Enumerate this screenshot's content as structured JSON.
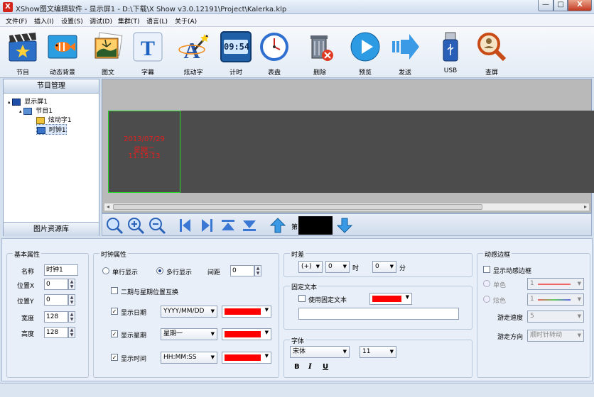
{
  "window": {
    "title": "XShow图文编辑软件 - 显示屏1 - D:\\下载\\X Show v3.0.12191\\Project\\Kalerka.klp",
    "app_icon_letter": "X",
    "min_glyph": "—",
    "max_glyph": "□",
    "close_glyph": "X"
  },
  "menu": [
    "文件(F)",
    "插入(I)",
    "设置(S)",
    "调试(D)",
    "集群(T)",
    "语言(L)",
    "关于(A)"
  ],
  "toolbar": {
    "program": "节目",
    "dynamic_bg": "动态背景",
    "image_text": "图文",
    "caption": "字幕",
    "flash_text": "炫动字",
    "timer": "计时",
    "timer_display": "09:54",
    "clock_face": "表盘",
    "delete": "删除",
    "preview": "预览",
    "send": "发送",
    "usb": "USB",
    "lock_screen": "查屏"
  },
  "left_panel": {
    "header": "节目管理",
    "tree": {
      "screen": "显示屏1",
      "program": "节目1",
      "flash_text": "炫动字1",
      "clock": "时钟1"
    },
    "footer": "图片资源库"
  },
  "canvas": {
    "clock_date": "2013/07/29",
    "clock_weekday": "星期二",
    "clock_time": "11:15:13",
    "scroll_left": "◂",
    "scroll_right": "▸"
  },
  "canvas_toolbar": {
    "page_label": "第"
  },
  "basic_props": {
    "title": "基本属性",
    "name_label": "名称",
    "name_value": "时钟1",
    "pos_x_label": "位置X",
    "pos_x_value": "0",
    "pos_y_label": "位置Y",
    "pos_y_value": "0",
    "width_label": "宽度",
    "width_value": "128",
    "height_label": "高度",
    "height_value": "128"
  },
  "clock_props": {
    "title": "时钟属性",
    "single_line": "单行显示",
    "multi_line": "多行显示",
    "spacing_label": "间距",
    "spacing_value": "0",
    "swap_date_week": "二期与星期位置互换",
    "show_date": "显示日期",
    "date_format": "YYYY/MM/DD",
    "show_week": "显示星期",
    "week_format": "星期一",
    "show_time": "显示时间",
    "time_format": "HH:MM:SS"
  },
  "timezone": {
    "title": "时差",
    "sign": "(+)",
    "hour_value": "0",
    "hour_unit": "时",
    "min_value": "0",
    "min_unit": "分"
  },
  "fixed_text": {
    "title": "固定文本",
    "show_label": "使用固定文本",
    "value": ""
  },
  "font": {
    "title": "字体",
    "family": "宋体",
    "size": "11",
    "bold": "B",
    "italic": "I",
    "underline": "U"
  },
  "border": {
    "title": "动感边框",
    "show_label": "显示动感边框",
    "mono_label": "单色",
    "mono_value": "1",
    "multi_label": "炫色",
    "multi_value": "1",
    "speed_label": "游走速度",
    "speed_value": "5",
    "direction_label": "游走方向",
    "direction_value": "顺时针转动"
  },
  "colors": {
    "accent_red": "#ff0000",
    "canvas_bg": "#4c4c4c",
    "clock_text": "#e02020",
    "select_green": "#27d627"
  }
}
